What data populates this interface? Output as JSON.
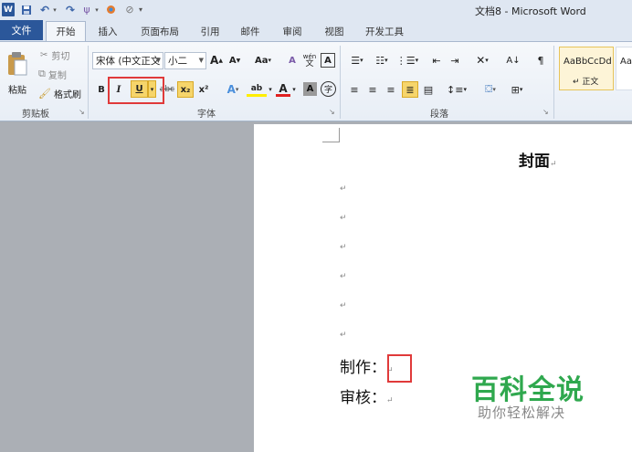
{
  "window": {
    "title": "文档8 - Microsoft Word"
  },
  "qat": {
    "app_icon": "word-icon",
    "save_icon": "save-icon",
    "undo_icon": "undo-icon",
    "redo_icon": "redo-icon"
  },
  "tabs": {
    "file": "文件",
    "items": [
      "开始",
      "插入",
      "页面布局",
      "引用",
      "邮件",
      "审阅",
      "视图",
      "开发工具"
    ],
    "active": "开始"
  },
  "ribbon": {
    "clipboard": {
      "paste": "粘贴",
      "cut": "剪切",
      "copy": "复制",
      "format_painter": "格式刷",
      "label": "剪贴板"
    },
    "font": {
      "font_name": "宋体 (中文正文",
      "font_size": "小二",
      "grow": "A",
      "shrink": "A",
      "case": "Aa",
      "clear": "A",
      "phonetic": "wén",
      "border_char": "A",
      "bold": "B",
      "italic": "I",
      "underline": "U",
      "strike": "abc",
      "subscript": "x₂",
      "superscript": "x²",
      "effects": "A",
      "highlight": "ab",
      "font_color": "A",
      "shading": "A",
      "enclose": "字",
      "label": "字体"
    },
    "paragraph": {
      "label": "段落"
    },
    "styles": {
      "normal_preview": "AaBbCcDd",
      "normal_name": "↵ 正文",
      "next_preview": "Aa"
    }
  },
  "document": {
    "title": "封面",
    "mark": "↵",
    "made_by_label": "制作：",
    "reviewed_by_label": "审核："
  },
  "watermark": {
    "main": "百科全说",
    "sub": "助你轻松解决"
  },
  "colors": {
    "file_tab": "#2b579a",
    "highlight_box": "#e03a3a",
    "watermark": "#2fa84e",
    "style_selected": "#fdf4d7"
  }
}
